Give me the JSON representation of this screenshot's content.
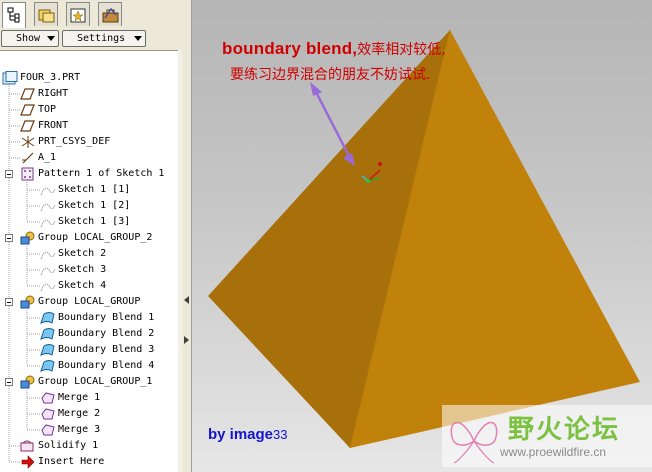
{
  "model_tree": {
    "toolbar": {
      "show_label": "Show",
      "settings_label": "Settings"
    },
    "items": [
      {
        "label": "FOUR_3.PRT",
        "icon": "part-icon"
      },
      {
        "label": "RIGHT",
        "icon": "datum-plane-icon"
      },
      {
        "label": "TOP",
        "icon": "datum-plane-icon"
      },
      {
        "label": "FRONT",
        "icon": "datum-plane-icon"
      },
      {
        "label": "PRT_CSYS_DEF",
        "icon": "csys-icon"
      },
      {
        "label": "A_1",
        "icon": "datum-axis-icon"
      },
      {
        "label": "Pattern 1 of Sketch 1",
        "icon": "pattern-icon"
      },
      {
        "label": "Sketch 1 [1]",
        "icon": "sketch-icon"
      },
      {
        "label": "Sketch 1 [2]",
        "icon": "sketch-icon"
      },
      {
        "label": "Sketch 1 [3]",
        "icon": "sketch-icon"
      },
      {
        "label": "Group LOCAL_GROUP_2",
        "icon": "group-icon"
      },
      {
        "label": "Sketch 2",
        "icon": "sketch-icon"
      },
      {
        "label": "Sketch 3",
        "icon": "sketch-icon"
      },
      {
        "label": "Sketch 4",
        "icon": "sketch-icon"
      },
      {
        "label": "Group LOCAL_GROUP",
        "icon": "group-icon"
      },
      {
        "label": "Boundary Blend 1",
        "icon": "boundary-blend-icon"
      },
      {
        "label": "Boundary Blend 2",
        "icon": "boundary-blend-icon"
      },
      {
        "label": "Boundary Blend 3",
        "icon": "boundary-blend-icon"
      },
      {
        "label": "Boundary Blend 4",
        "icon": "boundary-blend-icon"
      },
      {
        "label": "Group LOCAL_GROUP_1",
        "icon": "group-icon"
      },
      {
        "label": "Merge 1",
        "icon": "merge-icon"
      },
      {
        "label": "Merge 2",
        "icon": "merge-icon"
      },
      {
        "label": "Merge 3",
        "icon": "merge-icon"
      },
      {
        "label": "Solidify 1",
        "icon": "solidify-icon"
      },
      {
        "label": "Insert Here",
        "icon": "insert-here-arrow-icon"
      }
    ]
  },
  "viewport": {
    "annotation_en": "boundary blend,",
    "annotation_cn1": "效率相对较低,",
    "annotation_cn2": "要练习边界混合的朋友不妨试试.",
    "credit_text": "by image",
    "credit_number": "33",
    "watermark_title": "野火论坛",
    "watermark_url": "www.proewildfire.cn"
  },
  "colors": {
    "pyramid_left_face": "#a8700a",
    "pyramid_right_face": "#c0820b",
    "pyramid_edge": "#b47a0b",
    "annotation_text": "#d00000",
    "leader_line": "#9a6ad8",
    "credit_text": "#1414c8",
    "watermark_green": "#7cc242"
  }
}
